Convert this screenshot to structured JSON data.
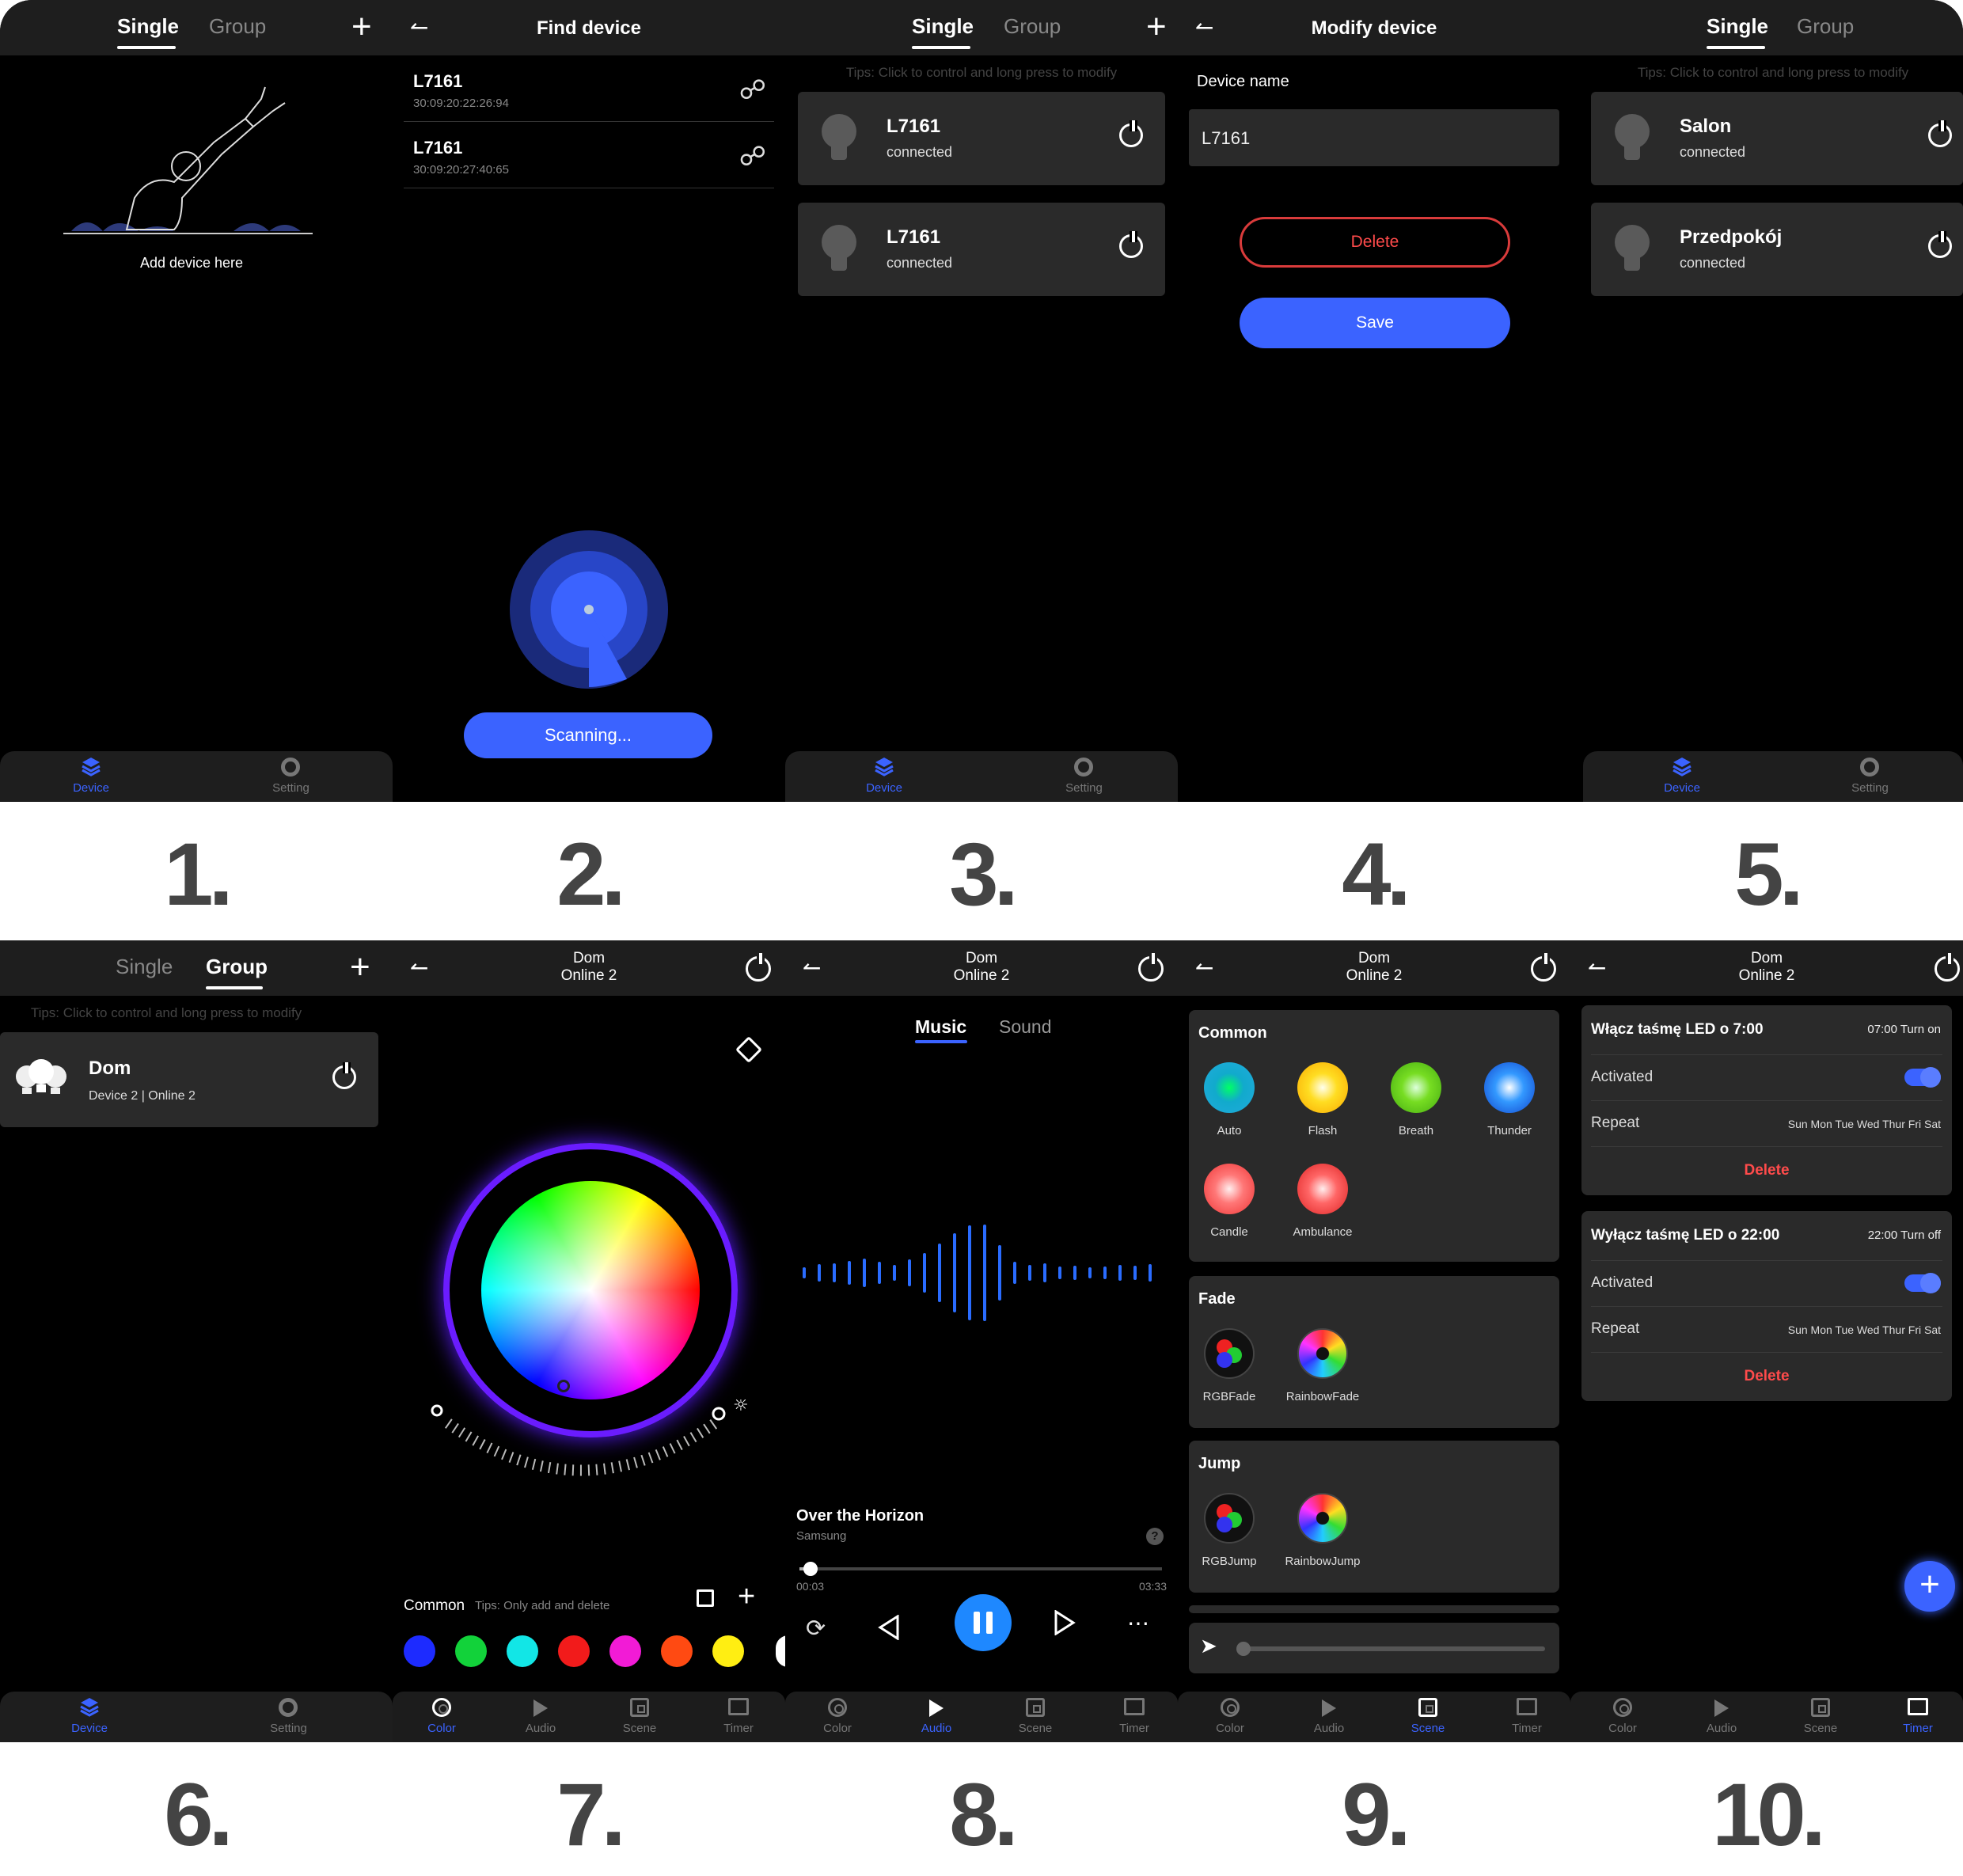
{
  "tabs": {
    "single": "Single",
    "group": "Group"
  },
  "tips": "Tips: Click to control and long press to modify",
  "nav": {
    "device": "Device",
    "setting": "Setting",
    "color": "Color",
    "audio": "Audio",
    "scene": "Scene",
    "timer": "Timer"
  },
  "screen1": {
    "empty_label": "Add device here"
  },
  "screen2": {
    "title": "Find device",
    "devices": [
      {
        "name": "L7161",
        "mac": "30:09:20:22:26:94"
      },
      {
        "name": "L7161",
        "mac": "30:09:20:27:40:65"
      }
    ],
    "scan_label": "Scanning..."
  },
  "screen3": {
    "devices": [
      {
        "name": "L7161",
        "status": "connected"
      },
      {
        "name": "L7161",
        "status": "connected"
      }
    ]
  },
  "screen4": {
    "title": "Modify device",
    "field_label": "Device name",
    "field_value": "L7161",
    "delete_label": "Delete",
    "save_label": "Save"
  },
  "screen5": {
    "devices": [
      {
        "name": "Salon",
        "status": "connected"
      },
      {
        "name": "Przedpokój",
        "status": "connected"
      }
    ]
  },
  "screen6": {
    "group_name": "Dom",
    "group_info": "Device 2 | Online 2"
  },
  "group_header": {
    "name": "Dom",
    "online": "Online 2"
  },
  "screen7": {
    "common_label": "Common",
    "common_tip": "Tips: Only add and delete",
    "swatches": [
      "#1d2bff",
      "#12d23a",
      "#12e6e6",
      "#f21b1b",
      "#f21bd6",
      "#ff4a12",
      "#ffee12",
      "#ffffff"
    ]
  },
  "screen8": {
    "tab_music": "Music",
    "tab_sound": "Sound",
    "song": "Over the Horizon",
    "artist": "Samsung",
    "time_current": "00:03",
    "time_total": "03:33",
    "progress": 0.03
  },
  "screen9": {
    "sections": [
      {
        "title": "Common",
        "items": [
          "Auto",
          "Flash",
          "Breath",
          "Thunder",
          "Candle",
          "Ambulance"
        ]
      },
      {
        "title": "Fade",
        "items": [
          "RGBFade",
          "RainbowFade"
        ]
      },
      {
        "title": "Jump",
        "items": [
          "RGBJump",
          "RainbowJump"
        ]
      }
    ]
  },
  "screen10": {
    "timers": [
      {
        "title": "Włącz taśmę LED o 7:00",
        "schedule": "07:00 Turn on",
        "activated_label": "Activated",
        "activated": true,
        "repeat_label": "Repeat",
        "repeat_days": "Sun Mon Tue Wed Thur Fri Sat",
        "delete_label": "Delete"
      },
      {
        "title": "Wyłącz taśmę LED o 22:00",
        "schedule": "22:00 Turn off",
        "activated_label": "Activated",
        "activated": true,
        "repeat_label": "Repeat",
        "repeat_days": "Sun Mon Tue Wed Thur Fri Sat",
        "delete_label": "Delete"
      }
    ]
  },
  "step_numbers": [
    "1.",
    "2.",
    "3.",
    "4.",
    "5.",
    "6.",
    "7.",
    "8.",
    "9.",
    "10."
  ],
  "colors": {
    "accent": "#3b63ff",
    "danger": "#ff4b4b",
    "card": "#2a2a2a",
    "header": "#1e1e1e"
  }
}
